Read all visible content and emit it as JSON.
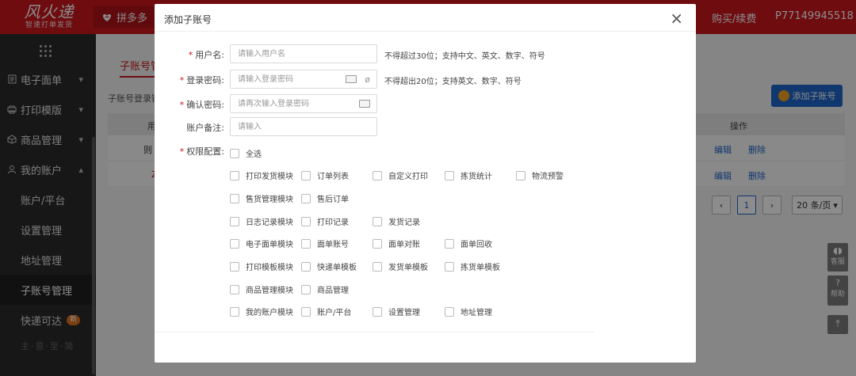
{
  "header": {
    "logo_main": "风火递",
    "logo_sub": "智速打单发货",
    "platform_tab": "拼多多",
    "buy_renew": "购买/续费",
    "account_id": "P77149945518"
  },
  "sidebar": {
    "items": [
      {
        "label": "电子面单",
        "icon": "document-icon"
      },
      {
        "label": "打印模版",
        "icon": "printer-icon"
      },
      {
        "label": "商品管理",
        "icon": "box-icon"
      },
      {
        "label": "我的账户",
        "icon": "user-icon"
      }
    ],
    "sub_items": [
      "账户/平台",
      "设置管理",
      "地址管理",
      "子账号管理",
      "快递可达"
    ],
    "new_badge": "新",
    "footer_text": "主·意·至·简"
  },
  "main": {
    "tab_label": "子账号管",
    "hint": "子账号登录链",
    "add_button": "添加子账号",
    "col_user": "用",
    "col_action": "操作",
    "row1_prefix": "则",
    "row2_prefix": "Z",
    "edit": "编辑",
    "delete": "删除",
    "page_current": "1",
    "page_size": "20 条/页",
    "widget_service": "客服",
    "widget_help": "帮助"
  },
  "modal": {
    "title": "添加子账号",
    "close_icon": "close-icon",
    "fields": {
      "username": {
        "label": "用户名:",
        "placeholder": "请输入用户名",
        "note": "不得超过30位；支持中文、英文、数字、符号"
      },
      "password": {
        "label": "登录密码:",
        "placeholder": "请输入登录密码",
        "note": "不得超出20位；支持英文、数字、符号"
      },
      "confirm": {
        "label": "确认密码:",
        "placeholder": "请再次输入登录密码"
      },
      "remark": {
        "label": "账户备注:",
        "placeholder": "请输入"
      },
      "permissions": {
        "label": "权限配置:"
      }
    },
    "select_all": "全选",
    "perm_rows": [
      [
        "打印发货模块",
        "订单列表",
        "自定义打印",
        "拣货统计",
        "物流预警"
      ],
      [
        "售货管理模块",
        "售后订单"
      ],
      [
        "日志记录模块",
        "打印记录",
        "发货记录"
      ],
      [
        "电子面单模块",
        "面单账号",
        "面单对账",
        "面单回收"
      ],
      [
        "打印模板模块",
        "快递单模板",
        "发货单模板",
        "拣货单模板"
      ],
      [
        "商品管理模块",
        "商品管理"
      ],
      [
        "我的账户模块",
        "账户/平台",
        "设置管理",
        "地址管理"
      ]
    ]
  },
  "colors": {
    "brand_red": "#c8161d",
    "link_blue": "#1e64c8"
  }
}
